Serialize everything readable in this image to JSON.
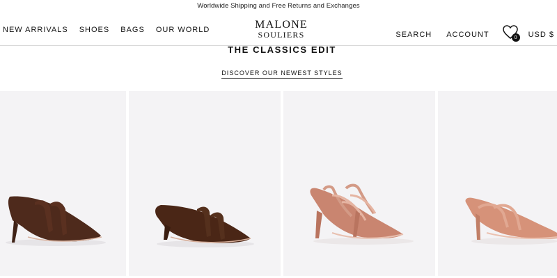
{
  "announcement": "Worldwide Shipping and Free Returns and Exchanges",
  "nav_left": [
    "NEW ARRIVALS",
    "SHOES",
    "BAGS",
    "OUR WORLD"
  ],
  "logo": {
    "line1": "MALONE",
    "line2": "SOULIERS"
  },
  "nav_right": {
    "search": "SEARCH",
    "account": "ACCOUNT",
    "currency": "USD $"
  },
  "wishlist": {
    "icon": "heart-icon",
    "count": "0"
  },
  "edit": {
    "title": "THE CLASSICS EDIT",
    "link": "DISCOVER OUR NEWEST STYLES"
  },
  "products": [
    {
      "color": "#4e2a1c",
      "strap": "#5a3020"
    },
    {
      "color": "#4a2616",
      "strap": "#55301d"
    },
    {
      "color": "#c98570",
      "strap": "#d39a86"
    },
    {
      "color": "#d69279",
      "strap": "#e1a892"
    }
  ],
  "colors": {
    "tile_bg": "#f4f3f5",
    "divider": "#d9d9d9",
    "text": "#111111"
  }
}
